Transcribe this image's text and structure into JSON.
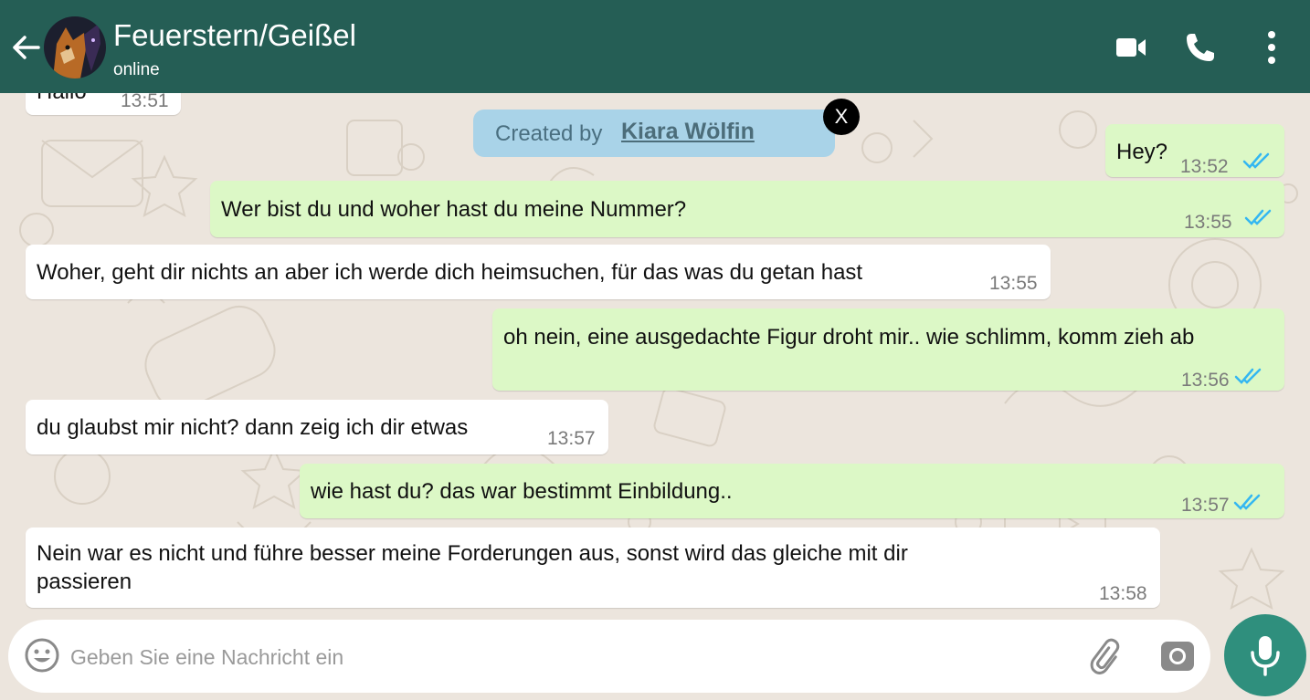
{
  "header": {
    "contact_name": "Feuerstern/Geißel",
    "status": "online"
  },
  "watermark": {
    "prefix": "Created by",
    "author": "Kiara Wölfin",
    "close_label": "X"
  },
  "messages": [
    {
      "direction": "in",
      "text": "Hallo",
      "time": "13:51"
    },
    {
      "direction": "out",
      "text": "Hey?",
      "time": "13:52",
      "read": true
    },
    {
      "direction": "out",
      "text": "Wer bist du und woher hast du meine Nummer?",
      "time": "13:55",
      "read": true
    },
    {
      "direction": "in",
      "text": "Woher, geht dir nichts an aber ich werde dich heimsuchen, für das was du getan hast",
      "time": "13:55"
    },
    {
      "direction": "out",
      "text": "oh nein, eine ausgedachte Figur droht mir.. wie schlimm, komm zieh ab",
      "time": "13:56",
      "read": true
    },
    {
      "direction": "in",
      "text": "du glaubst mir nicht? dann zeig ich dir etwas",
      "time": "13:57"
    },
    {
      "direction": "out",
      "text": "wie hast du? das war bestimmt Einbildung..",
      "time": "13:57",
      "read": true
    },
    {
      "direction": "in",
      "text_lines": [
        "Nein war es nicht und führe besser meine Forderungen aus, sonst wird das gleiche mit dir",
        "passieren"
      ],
      "time": "13:58"
    }
  ],
  "composer": {
    "placeholder": "Geben Sie eine Nachricht ein"
  },
  "icons": {
    "back": "arrow-left-icon",
    "video": "video-camera-icon",
    "call": "phone-icon",
    "more": "more-vert-icon",
    "emoji": "emoji-icon",
    "attach": "paperclip-icon",
    "camera": "camera-icon",
    "mic": "microphone-icon",
    "read_receipt": "double-check-icon"
  },
  "colors": {
    "header": "#255e55",
    "chat_background": "#ece5dd",
    "incoming_bubble": "#ffffff",
    "outgoing_bubble": "#dcf8c6",
    "read_tick": "#34b7f1",
    "mic_button": "#2f8f7d",
    "watermark": "#a9d3e8"
  }
}
